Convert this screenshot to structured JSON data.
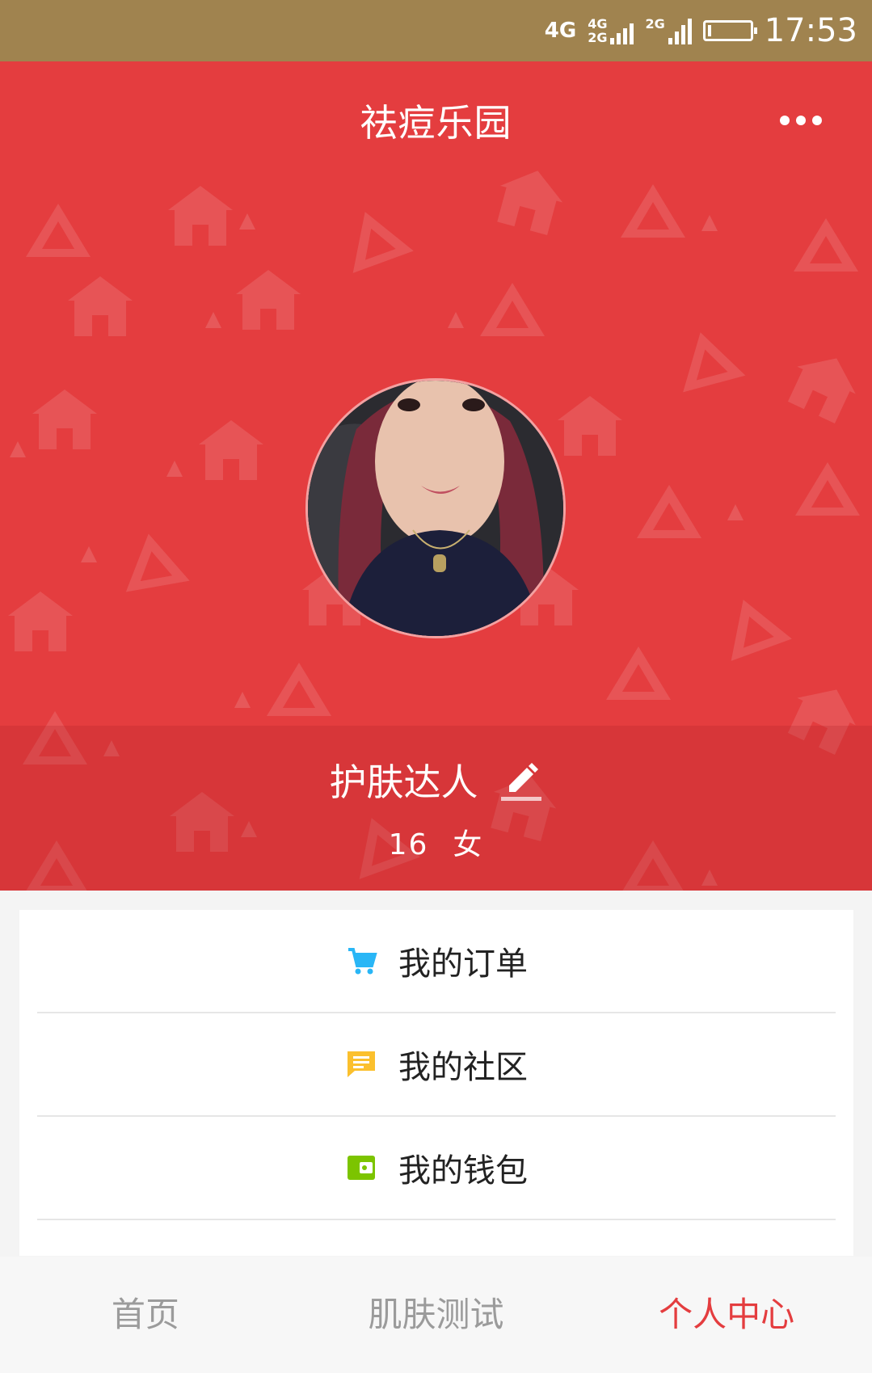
{
  "status_bar": {
    "network_primary": "4G",
    "network_sim1": "4G",
    "network_sim1_sub": "2G",
    "network_sim2": "2G",
    "time": "17:53",
    "battery_icon": "battery-low-icon",
    "battery_level": 0.1
  },
  "header": {
    "title": "祛痘乐园",
    "more_icon": "more-horizontal-icon",
    "background_color": "#e43d3f"
  },
  "profile": {
    "avatar": "user-avatar-photo",
    "nickname": "护肤达人",
    "edit_icon": "edit-pencil-icon",
    "age": "16",
    "gender": "女"
  },
  "menu": {
    "items": [
      {
        "label": "我的订单",
        "icon": "cart-icon",
        "icon_color": "#29b6f6"
      },
      {
        "label": "我的社区",
        "icon": "message-icon",
        "icon_color": "#fbc02d"
      },
      {
        "label": "我的钱包",
        "icon": "wallet-icon",
        "icon_color": "#7cc400"
      }
    ]
  },
  "tab_bar": {
    "tabs": [
      {
        "label": "首页",
        "active": false
      },
      {
        "label": "肌肤测试",
        "active": false
      },
      {
        "label": "个人中心",
        "active": true
      }
    ],
    "active_color": "#e43d3f"
  }
}
